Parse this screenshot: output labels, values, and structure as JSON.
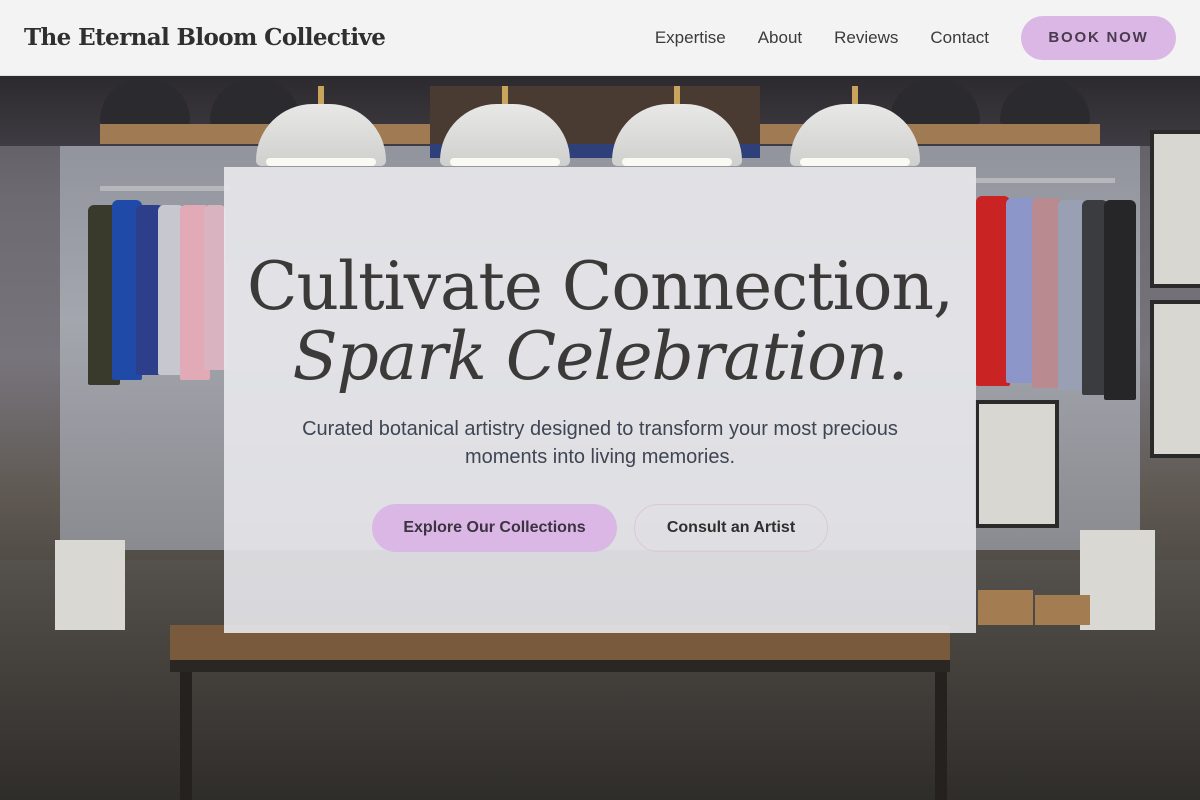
{
  "header": {
    "brand": "The Eternal Bloom Collective",
    "nav": [
      "Expertise",
      "About",
      "Reviews",
      "Contact"
    ],
    "book_label": "BOOK NOW"
  },
  "hero": {
    "headline_line1": "Cultivate Connection,",
    "headline_line2": "Spark Celebration.",
    "subtitle": "Curated botanical artistry designed to transform your most precious moments into living memories.",
    "primary_cta": "Explore Our Collections",
    "secondary_cta": "Consult an Artist"
  },
  "colors": {
    "accent": "#dbb7e6",
    "header_bg": "#fafafa",
    "text": "#3c3a39"
  }
}
